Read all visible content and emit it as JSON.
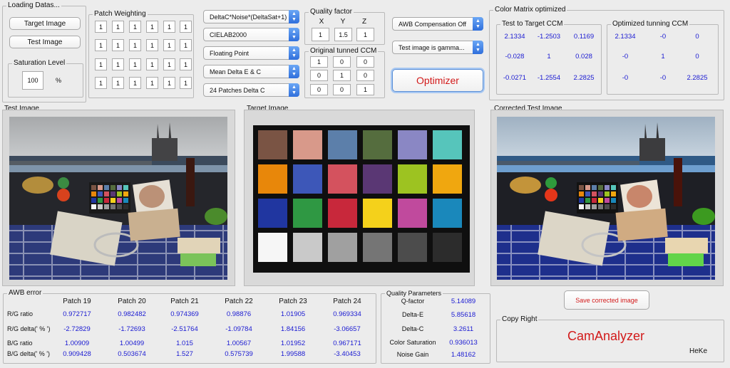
{
  "loading": {
    "title": "Loading Datas...",
    "target_image_btn": "Target Image",
    "test_image_btn": "Test Image"
  },
  "saturation": {
    "title": "Saturation Level",
    "value": "100",
    "unit": "%"
  },
  "patch_weighting": {
    "title": "Patch Weighting",
    "rows": [
      [
        "1",
        "1",
        "1",
        "1",
        "1",
        "1"
      ],
      [
        "1",
        "1",
        "1",
        "1",
        "1",
        "1"
      ],
      [
        "1",
        "1",
        "1",
        "1",
        "1",
        "1"
      ],
      [
        "1",
        "1",
        "1",
        "1",
        "1",
        "1"
      ]
    ]
  },
  "combos": {
    "formula": "DeltaC*Noise*(DeltaSat+1)",
    "colorspace": "CIELAB2000",
    "precision": "Floating Point",
    "metric": "Mean Delta E & C",
    "patches": "24 Patches Delta C"
  },
  "quality_factor": {
    "title": "Quality factor",
    "headers": [
      "X",
      "Y",
      "Z"
    ],
    "values": [
      "1",
      "1.5",
      "1"
    ]
  },
  "original_ccm": {
    "title": "Original tunned CCM",
    "rows": [
      [
        "1",
        "0",
        "0"
      ],
      [
        "0",
        "1",
        "0"
      ],
      [
        "0",
        "0",
        "1"
      ]
    ]
  },
  "awb_combo": "AWB Compensation Off",
  "gamma_combo": "Test image is gamma...",
  "optimizer_btn": "Optimizer",
  "color_matrix": {
    "title": "Color Matrix optimized",
    "test_to_target": {
      "title": "Test to Target CCM",
      "rows": [
        [
          "2.1334",
          "-1.2503",
          "0.1169"
        ],
        [
          "-0.028",
          "1",
          "0.028"
        ],
        [
          "-0.0271",
          "-1.2554",
          "2.2825"
        ]
      ]
    },
    "optimized": {
      "title": "Optimized tunning CCM",
      "rows": [
        [
          "2.1334",
          "-0",
          "0"
        ],
        [
          "-0",
          "1",
          "0"
        ],
        [
          "-0",
          "-0",
          "2.2825"
        ]
      ]
    }
  },
  "test_image_title": "Test Image",
  "target_image_title": "Target Image",
  "corrected_image_title": "Corrected Test Image",
  "color_checker": {
    "rows": [
      [
        "#7a5444",
        "#d8998a",
        "#5c7faa",
        "#556d3e",
        "#8a87c4",
        "#56c5bb"
      ],
      [
        "#e8870a",
        "#3d57b8",
        "#d4525e",
        "#5a3774",
        "#9dc321",
        "#f0a70f"
      ],
      [
        "#2036a0",
        "#2f9843",
        "#c8283b",
        "#f4d11b",
        "#c04a9d",
        "#1a88bb"
      ],
      [
        "#f6f6f6",
        "#c9c9c9",
        "#a0a0a0",
        "#757575",
        "#4c4c4c",
        "#2c2c2c"
      ]
    ]
  },
  "awb_error": {
    "title": "AWB error",
    "columns": [
      "Patch 19",
      "Patch 20",
      "Patch 21",
      "Patch 22",
      "Patch 23",
      "Patch 24"
    ],
    "rows": [
      {
        "label": "R/G ratio",
        "values": [
          "0.972717",
          "0.982482",
          "0.974369",
          "0.98876",
          "1.01905",
          "0.969334"
        ]
      },
      {
        "label": "R/G delta(' % ')",
        "values": [
          "-2.72829",
          "-1.72693",
          "-2.51764",
          "-1.09784",
          "1.84156",
          "-3.06657"
        ]
      },
      {
        "label": "B/G ratio",
        "values": [
          "1.00909",
          "1.00499",
          "1.015",
          "1.00567",
          "1.01952",
          "0.967171"
        ]
      },
      {
        "label": "B/G delta(' % ')",
        "values": [
          "0.909428",
          "0.503674",
          "1.527",
          "0.575739",
          "1.99588",
          "-3.40453"
        ]
      }
    ]
  },
  "quality_params": {
    "title": "Quality Parameters",
    "rows": [
      {
        "label": "Q-factor",
        "value": "5.14089"
      },
      {
        "label": "Delta-E",
        "value": "5.85618"
      },
      {
        "label": "Delta-C",
        "value": "3.2611"
      },
      {
        "label": "Color Saturation",
        "value": "0.936013"
      },
      {
        "label": "Noise Gain",
        "value": "1.48162"
      }
    ]
  },
  "save_btn": "Save corrected image",
  "copyright": {
    "title": "Copy Right",
    "app": "CamAnalyzer",
    "author": "HeKe"
  }
}
